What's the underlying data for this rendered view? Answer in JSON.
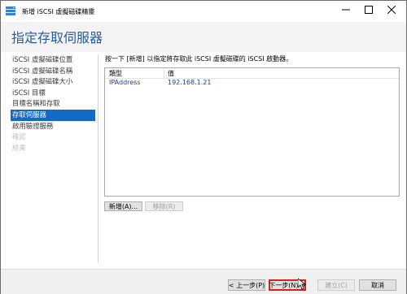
{
  "window": {
    "title": "新增 iSCSI 虛擬磁碟精靈"
  },
  "header": {
    "title": "指定存取伺服器"
  },
  "sidebar": {
    "items": [
      {
        "label": "iSCSI 虛擬磁碟位置"
      },
      {
        "label": "iSCSI 虛擬磁碟名稱"
      },
      {
        "label": "iSCSI 虛擬磁碟大小"
      },
      {
        "label": "iSCSI 目標"
      },
      {
        "label": "目標名稱和存取"
      },
      {
        "label": "存取伺服器"
      },
      {
        "label": "啟用驗證服務"
      },
      {
        "label": "確認"
      },
      {
        "label": "結果"
      }
    ]
  },
  "main": {
    "instruction": "按一下 [新增] 以指定將存取此 iSCSI 虛擬磁碟的 iSCSI 啟動器。",
    "table": {
      "columns": [
        "類型",
        "值"
      ],
      "rows": [
        {
          "type": "IPAddress",
          "value": "192.168.1.21"
        }
      ]
    },
    "add_button": "新增(A)...",
    "remove_button": "移除(R)"
  },
  "footer": {
    "prev": "< 上一步(P)",
    "next": "下一步(N) >",
    "finish": "建立(C)",
    "cancel": "取消"
  },
  "colors": {
    "accent": "#1469c7",
    "title": "#2a5b9a",
    "highlight": "#d62020"
  }
}
